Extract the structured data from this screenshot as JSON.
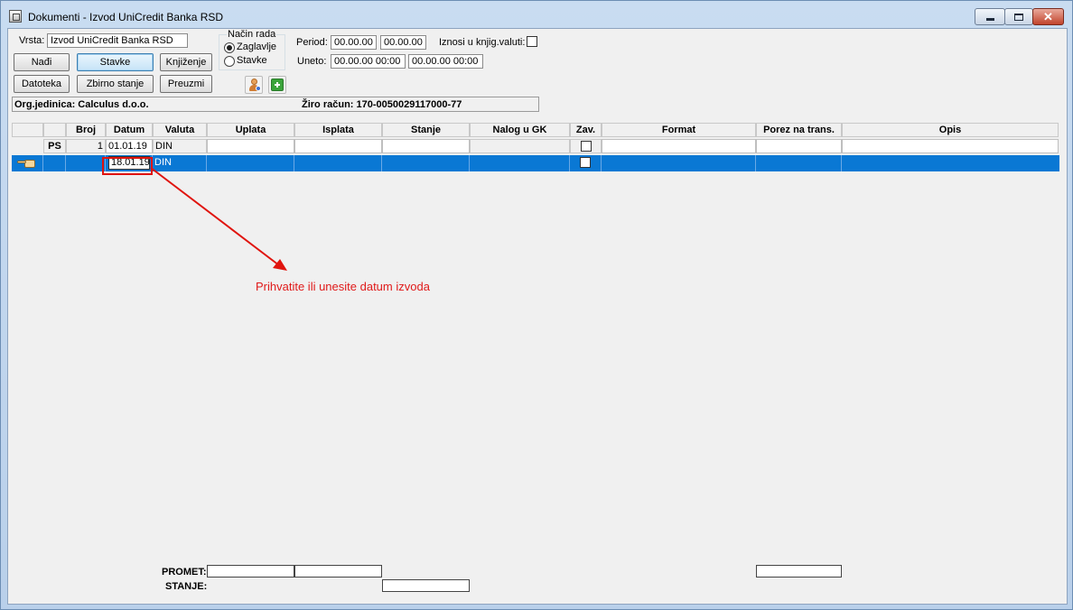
{
  "window": {
    "title": "Dokumenti - Izvod UniCredit Banka RSD",
    "close_glyph": "✕"
  },
  "header": {
    "vrsta_label": "Vrsta:",
    "vrsta_value": "Izvod UniCredit Banka RSD",
    "nacin_rada_label": "Način rada",
    "mode_options": [
      "Zaglavlje",
      "Stavke"
    ],
    "mode_selected": "Zaglavlje",
    "period_label": "Period:",
    "period_from": "00.00.00",
    "period_to": "00.00.00",
    "uneto_label": "Uneto:",
    "uneto_from": "00.00.00 00:00",
    "uneto_to": "00.00.00 00:00",
    "iznosi_label": "Iznosi u knjig.valuti:"
  },
  "buttons": {
    "nadji": "Nađi",
    "stavke": "Stavke",
    "knjizenje": "Knjiženje",
    "datoteka": "Datoteka",
    "zbirno": "Zbirno stanje",
    "preuzmi": "Preuzmi"
  },
  "infobar": {
    "org": "Org.jedinica: Calculus d.o.o.",
    "ziro": "Žiro račun: 170-0050029117000-77"
  },
  "grid": {
    "columns": [
      "Broj",
      "Datum",
      "Valuta",
      "Uplata",
      "Isplata",
      "Stanje",
      "Nalog u GK",
      "Zav.",
      "Format",
      "Porez na trans.",
      "Opis"
    ],
    "rows": [
      {
        "marker": "PS",
        "broj": "1",
        "datum": "01.01.19",
        "valuta": "DIN"
      },
      {
        "marker": "",
        "broj": "",
        "datum": "18.01.19",
        "valuta": "DIN"
      }
    ]
  },
  "annotation": "Prihvatite ili unesite datum izvoda",
  "totals": {
    "promet_label": "PROMET:",
    "stanje_label": "STANJE:"
  },
  "colors": {
    "selection": "#0a78d4",
    "annotation": "#e01a1a"
  }
}
